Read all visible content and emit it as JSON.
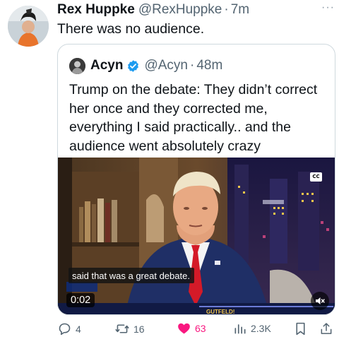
{
  "tweet": {
    "author_name": "Rex Huppke",
    "author_handle": "@RexHuppke",
    "separator": "·",
    "time": "7m",
    "text": "There was no audience.",
    "more_label": "···"
  },
  "quoted": {
    "author_name": "Acyn",
    "author_handle": "@Acyn",
    "separator": "·",
    "time": "48m",
    "text": "Trump on the debate: They didn’t correct her once and they corrected me, everything I said practically.. and the audience went absolutely crazy",
    "verified": true,
    "media": {
      "type": "video",
      "caption": "said that was a great debate.",
      "timestamp": "0:02",
      "cc_label": "CC",
      "muted": true,
      "background_text": "GUTFELD!"
    }
  },
  "actions": {
    "replies": "4",
    "reposts": "16",
    "likes": "63",
    "views": "2.3K"
  },
  "colors": {
    "text": "#0f1419",
    "secondary": "#536471",
    "like_active": "#f91880",
    "verified_blue": "#1d9bf0",
    "border": "#cfd9de"
  }
}
